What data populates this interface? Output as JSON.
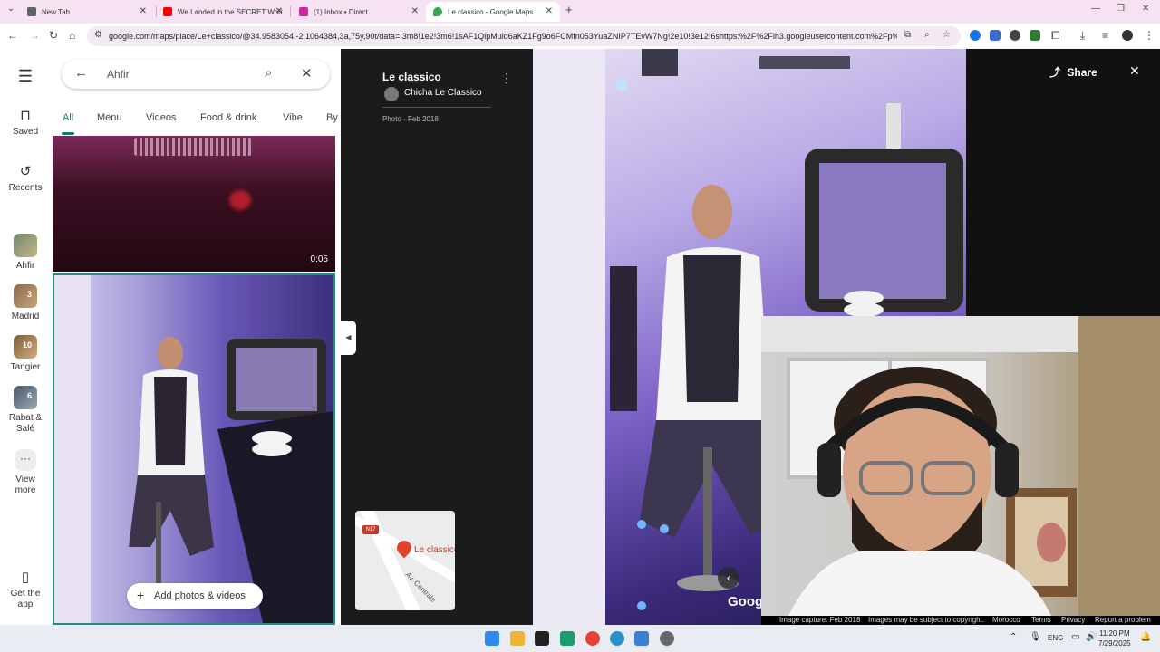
{
  "browser": {
    "tabs": [
      {
        "title": "New Tab",
        "favicon_color": "#5f6368"
      },
      {
        "title": "We Landed in the SECRET Worl",
        "favicon_color": "#ff0000"
      },
      {
        "title": "(1) Inbox • Direct",
        "favicon_color": "#d6249f"
      },
      {
        "title": "Le classico - Google Maps",
        "favicon_color": "#34a853"
      }
    ],
    "new_tab": "+",
    "url": "google.com/maps/place/Le+classico/@34.9583054,-2.1064384,3a,75y,90t/data=!3m8!1e2!3m6!1sAF1QipMuid6aKZ1Fg9o6FCMfn053YuaZNIP7TEvW7Ng!2e10!3e12!6shttps:%2F%2Flh3.googleusercontent.com%2Fp%2FAF1Qi"
  },
  "maps": {
    "menu_icon": "hamburger-icon",
    "rail": {
      "saved": "Saved",
      "recents": "Recents",
      "places": [
        {
          "label": "Ahfir",
          "count": ""
        },
        {
          "label": "Madrid",
          "count": "3"
        },
        {
          "label": "Tangier",
          "count": "10"
        },
        {
          "label": "Rabat & Salé",
          "count": "6"
        }
      ],
      "view_more": "View more",
      "get_app": "Get the app"
    },
    "search": {
      "value": "Ahfir"
    },
    "photo_tabs": [
      "All",
      "Menu",
      "Videos",
      "Food & drink",
      "Vibe",
      "By"
    ],
    "video_duration": "0:05",
    "add_photos": "Add photos & videos",
    "info": {
      "place_name": "Le classico",
      "author": "Chicha Le Classico",
      "photo_meta": "Photo · Feb 2018"
    },
    "minimap": {
      "road_shield": "N17",
      "pin_label": "Le classico",
      "street": "Av. Centrale"
    },
    "share": "Share",
    "logo": "Goog",
    "credits": [
      "Image capture: Feb 2018",
      "Images may be subject to copyright.",
      "Morocco",
      "Terms",
      "Privacy",
      "Report a problem"
    ]
  },
  "taskbar": {
    "lang": "ENG",
    "time": "11:20 PM",
    "date": "7/29/2025"
  }
}
